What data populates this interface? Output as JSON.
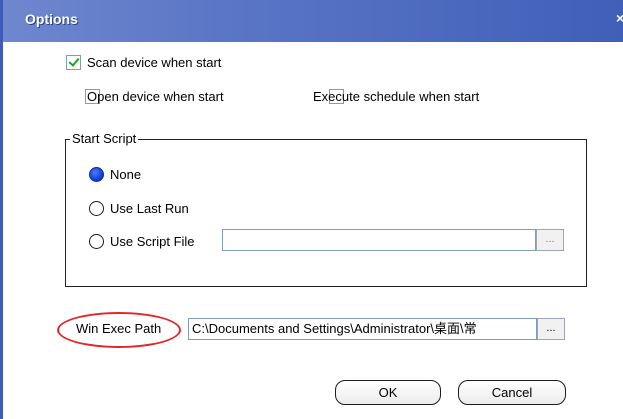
{
  "window": {
    "title": "Options",
    "close_glyph": "×"
  },
  "options": {
    "scan_device": {
      "label": "Scan device when start",
      "checked": true
    },
    "open_device": {
      "label": "Open device when start",
      "checked": false
    },
    "execute_schedule": {
      "label": "Execute schedule when start",
      "checked": false
    }
  },
  "start_script": {
    "legend": "Start Script",
    "none_label": "None",
    "use_last_run_label": "Use Last Run",
    "use_script_file_label": "Use Script File",
    "selected": "None",
    "script_file_value": "",
    "browse_label": "..."
  },
  "win_exec": {
    "label": "Win Exec Path",
    "value": "C:\\Documents and Settings\\Administrator\\桌面\\常",
    "browse_label": "..."
  },
  "buttons": {
    "ok": "OK",
    "cancel": "Cancel"
  },
  "colors": {
    "titlebar": "#3f5fb8",
    "highlight_ellipse": "#e0282b",
    "radio_selected": "#1241d6"
  }
}
